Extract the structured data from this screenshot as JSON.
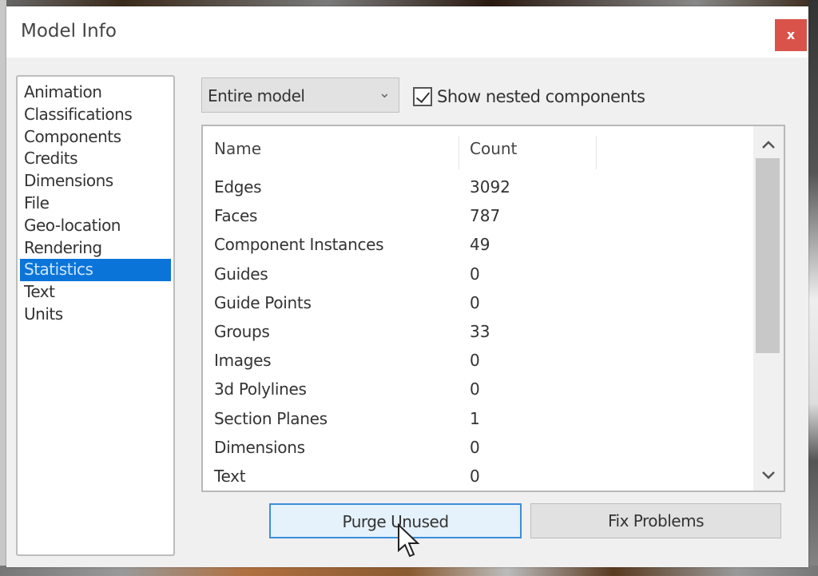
{
  "window": {
    "title": "Model Info",
    "close_label": "x"
  },
  "sidebar": {
    "items": [
      {
        "label": "Animation"
      },
      {
        "label": "Classifications"
      },
      {
        "label": "Components"
      },
      {
        "label": "Credits"
      },
      {
        "label": "Dimensions"
      },
      {
        "label": "File"
      },
      {
        "label": "Geo-location"
      },
      {
        "label": "Rendering"
      },
      {
        "label": "Statistics",
        "selected": true
      },
      {
        "label": "Text"
      },
      {
        "label": "Units"
      }
    ]
  },
  "scope": {
    "selected": "Entire model",
    "chevron_icon": "chevron-down-icon"
  },
  "nested": {
    "label": "Show nested components",
    "checked": true
  },
  "table": {
    "columns": [
      "Name",
      "Count"
    ],
    "rows": [
      {
        "name": "Edges",
        "count": "3092"
      },
      {
        "name": "Faces",
        "count": "787"
      },
      {
        "name": "Component Instances",
        "count": "49"
      },
      {
        "name": "Guides",
        "count": "0"
      },
      {
        "name": "Guide Points",
        "count": "0"
      },
      {
        "name": "Groups",
        "count": "33"
      },
      {
        "name": "Images",
        "count": "0"
      },
      {
        "name": "3d Polylines",
        "count": "0"
      },
      {
        "name": "Section Planes",
        "count": "1"
      },
      {
        "name": "Dimensions",
        "count": "0"
      },
      {
        "name": "Text",
        "count": "0"
      }
    ],
    "scroll_up_icon": "^",
    "scroll_down_icon": "v"
  },
  "buttons": {
    "purge": "Purge Unused",
    "fix": "Fix Problems"
  },
  "colors": {
    "selection": "#0a74d9",
    "close": "#d9534a",
    "focused_button_border": "#3c8fd9"
  }
}
